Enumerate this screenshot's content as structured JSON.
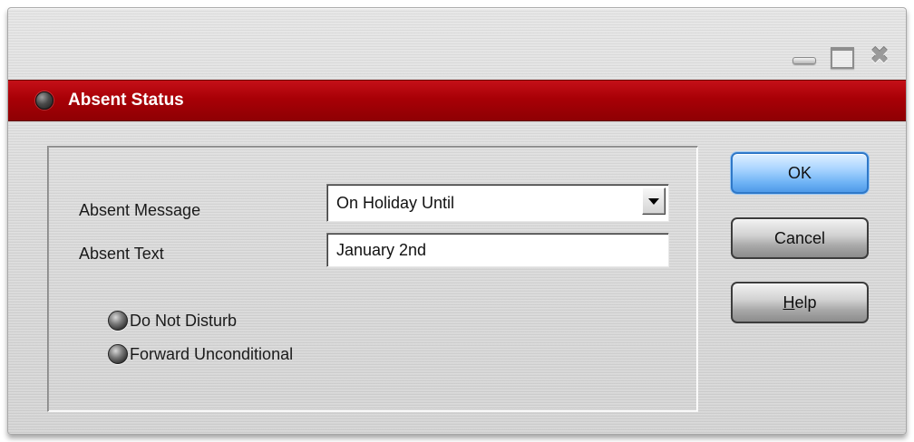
{
  "window": {
    "controls": {
      "minimize_icon": "minimize-icon",
      "maximize_icon": "maximize-icon",
      "close_icon": "close-icon",
      "close_glyph": "✖"
    }
  },
  "titlebar": {
    "title": "Absent Status",
    "color": "#a80006",
    "led_icon": "status-led-icon"
  },
  "form": {
    "absent_message": {
      "label": "Absent Message",
      "selected": "On Holiday Until"
    },
    "absent_text": {
      "label": "Absent Text",
      "value": "January 2nd"
    },
    "options": [
      {
        "label": "Do Not Disturb",
        "checked": false
      },
      {
        "label": "Forward Unconditional",
        "checked": false
      }
    ]
  },
  "buttons": {
    "ok": "OK",
    "cancel": "Cancel",
    "help_mnemonic": "H",
    "help_rest": "elp",
    "ok_color": "#6fb3f5"
  }
}
